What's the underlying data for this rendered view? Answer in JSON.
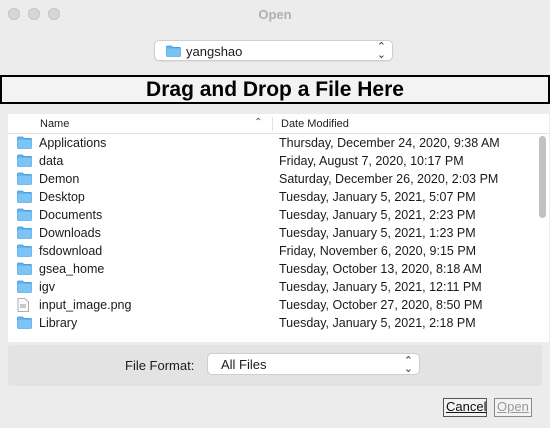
{
  "window": {
    "title": "Open"
  },
  "folder_popup": {
    "label": "yangshao",
    "icon": "folder-icon"
  },
  "dropzone": {
    "text": "Drag and Drop a File Here"
  },
  "columns": {
    "name": "Name",
    "date": "Date Modified",
    "sort": "ascending"
  },
  "files": [
    {
      "name": "Applications",
      "date": "Thursday, December 24, 2020, 9:38 AM",
      "kind": "folder"
    },
    {
      "name": "data",
      "date": "Friday, August 7, 2020, 10:17 PM",
      "kind": "folder"
    },
    {
      "name": "Demon",
      "date": "Saturday, December 26, 2020, 2:03 PM",
      "kind": "folder"
    },
    {
      "name": "Desktop",
      "date": "Tuesday, January 5, 2021, 5:07 PM",
      "kind": "folder"
    },
    {
      "name": "Documents",
      "date": "Tuesday, January 5, 2021, 2:23 PM",
      "kind": "folder"
    },
    {
      "name": "Downloads",
      "date": "Tuesday, January 5, 2021, 1:23 PM",
      "kind": "folder"
    },
    {
      "name": "fsdownload",
      "date": "Friday, November 6, 2020, 9:15 PM",
      "kind": "folder"
    },
    {
      "name": "gsea_home",
      "date": "Tuesday, October 13, 2020, 8:18 AM",
      "kind": "folder"
    },
    {
      "name": "igv",
      "date": "Tuesday, January 5, 2021, 12:11 PM",
      "kind": "folder"
    },
    {
      "name": "input_image.png",
      "date": "Tuesday, October 27, 2020, 8:50 PM",
      "kind": "file"
    },
    {
      "name": "Library",
      "date": "Tuesday, January 5, 2021, 2:18 PM",
      "kind": "folder"
    }
  ],
  "file_format": {
    "label": "File Format:",
    "value": "All Files"
  },
  "buttons": {
    "cancel": "Cancel",
    "open": "Open"
  }
}
